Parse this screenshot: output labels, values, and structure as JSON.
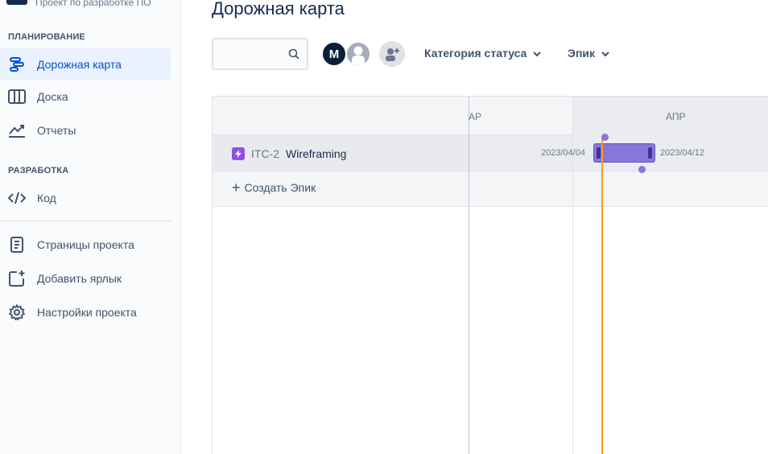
{
  "sidebar": {
    "project_subtitle": "Проект по разработке ПО",
    "planning_title": "ПЛАНИРОВАНИЕ",
    "development_title": "РАЗРАБОТКА",
    "items": [
      {
        "label": "Дорожная карта",
        "icon": "roadmap-icon",
        "active": true
      },
      {
        "label": "Доска",
        "icon": "board-icon",
        "active": false
      },
      {
        "label": "Отчеты",
        "icon": "reports-icon",
        "active": false
      },
      {
        "label": "Код",
        "icon": "code-icon",
        "active": false
      },
      {
        "label": "Страницы проекта",
        "icon": "page-icon",
        "active": false
      },
      {
        "label": "Добавить ярлык",
        "icon": "add-shortcut-icon",
        "active": false
      },
      {
        "label": "Настройки проекта",
        "icon": "gear-icon",
        "active": false
      }
    ]
  },
  "header": {
    "title": "Дорожная карта",
    "search_value": "",
    "avatar_initial": "M",
    "filters": [
      {
        "label": "Категория статуса"
      },
      {
        "label": "Эпик"
      }
    ]
  },
  "roadmap": {
    "months": [
      "АР",
      "АПР"
    ],
    "epic": {
      "key": "ITC-2",
      "name": "Wireframing",
      "start": "2023/04/04",
      "end": "2023/04/12"
    },
    "create_label": "Создать Эпик"
  },
  "colors": {
    "accent": "#0052cc",
    "epic": "#904ee2",
    "bar": "#8777d9",
    "today": "#ff991f"
  }
}
